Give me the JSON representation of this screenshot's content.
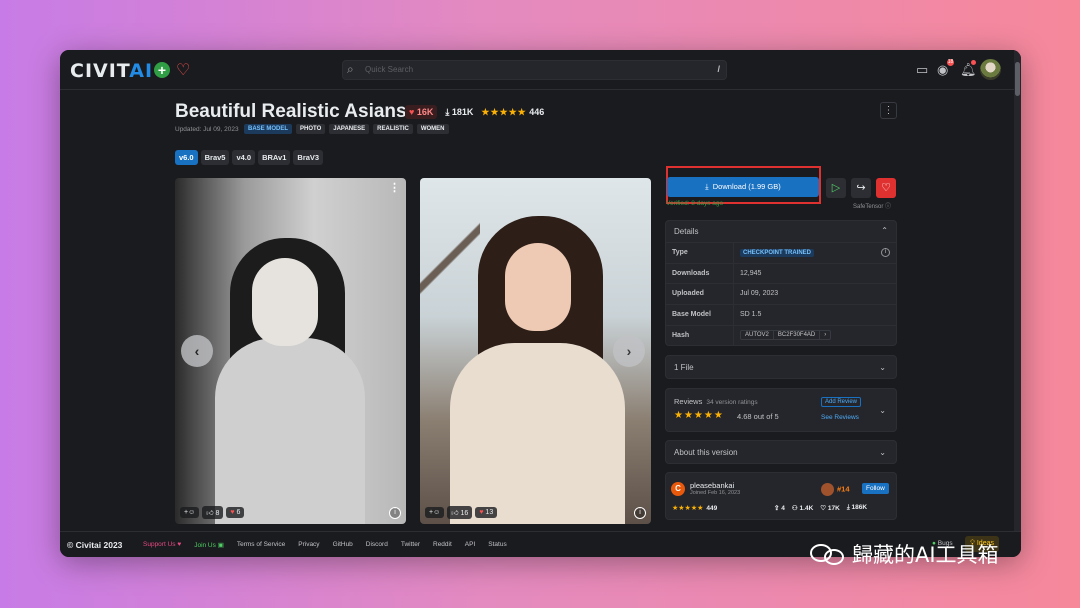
{
  "header": {
    "logo_main": "CIVIT",
    "logo_ai": "AI",
    "search_placeholder": "Quick Search",
    "search_shortcut": "/",
    "notif_count": "18"
  },
  "model": {
    "title": "Beautiful Realistic Asians",
    "likes": "16K",
    "downloads": "181K",
    "rating_count": "446",
    "updated": "Updated: Jul 09, 2023",
    "tags": [
      "BASE MODEL",
      "PHOTO",
      "JAPANESE",
      "REALISTIC",
      "WOMEN"
    ],
    "versions": [
      "v6.0",
      "Brav5",
      "v4.0",
      "BRAv1",
      "BraV3"
    ]
  },
  "gallery": [
    {
      "like": "8",
      "heart": "6"
    },
    {
      "like": "16",
      "heart": "13"
    }
  ],
  "download": {
    "label": "Download (1.99 GB)",
    "verified": "Verified: 8 days ago",
    "format": "SafeTensor"
  },
  "details": {
    "header": "Details",
    "rows": [
      {
        "key": "Type",
        "value": "CHECKPOINT TRAINED"
      },
      {
        "key": "Downloads",
        "value": "12,945"
      },
      {
        "key": "Uploaded",
        "value": "Jul 09, 2023"
      },
      {
        "key": "Base Model",
        "value": "SD 1.5"
      },
      {
        "key": "Hash",
        "value": "AUTOV2",
        "hash": "BC2F30F4AD"
      }
    ]
  },
  "files": {
    "label": "1 File"
  },
  "reviews": {
    "title": "Reviews",
    "count": "34 version ratings",
    "score": "4.68 out of 5",
    "add": "Add Review",
    "see": "See Reviews"
  },
  "about": {
    "label": "About this version"
  },
  "creator": {
    "name": "pleasebankai",
    "joined": "Joined Feb 16, 2023",
    "rank": "#14",
    "follow": "Follow",
    "rating_count": "449",
    "stats": [
      "4",
      "1.4K",
      "17K",
      "186K"
    ]
  },
  "footer": {
    "copyright": "© Civitai 2023",
    "links": [
      "Support Us",
      "Join Us",
      "Terms of Service",
      "Privacy",
      "GitHub",
      "Discord",
      "Twitter",
      "Reddit",
      "API",
      "Status"
    ],
    "bugs": "Bugs",
    "ideas": "Ideas"
  },
  "watermark": "歸藏的AI工具箱",
  "colors": {
    "accent": "#1971c2",
    "heart": "#e03131",
    "star": "#fab005",
    "highlight": "#e03131"
  }
}
